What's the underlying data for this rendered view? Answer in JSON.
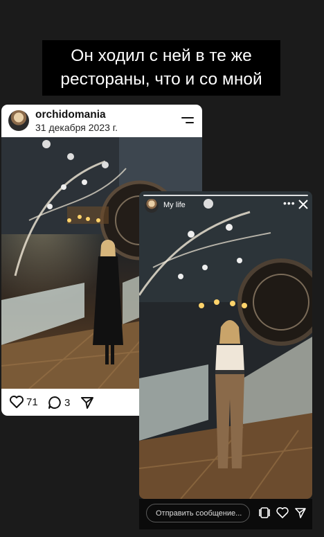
{
  "caption": {
    "line1": "Он ходил с ней в те же",
    "line2": "рестораны, что и со мной"
  },
  "post": {
    "username": "orchidomania",
    "date": "31 декабря 2023 г.",
    "likes": "71",
    "comments": "3"
  },
  "story": {
    "username": "My life",
    "reply_placeholder": "Отправить сообщение..."
  },
  "colors": {
    "background": "#1b1b1b",
    "caption_bg": "#000000",
    "card_bg": "#ffffff",
    "reply_bar": "#0b0b0b"
  },
  "icons": [
    "avatar",
    "menu-icon",
    "heart-icon",
    "comment-icon",
    "share-icon",
    "more-icon",
    "close-icon",
    "gallery-icon",
    "send-icon"
  ]
}
